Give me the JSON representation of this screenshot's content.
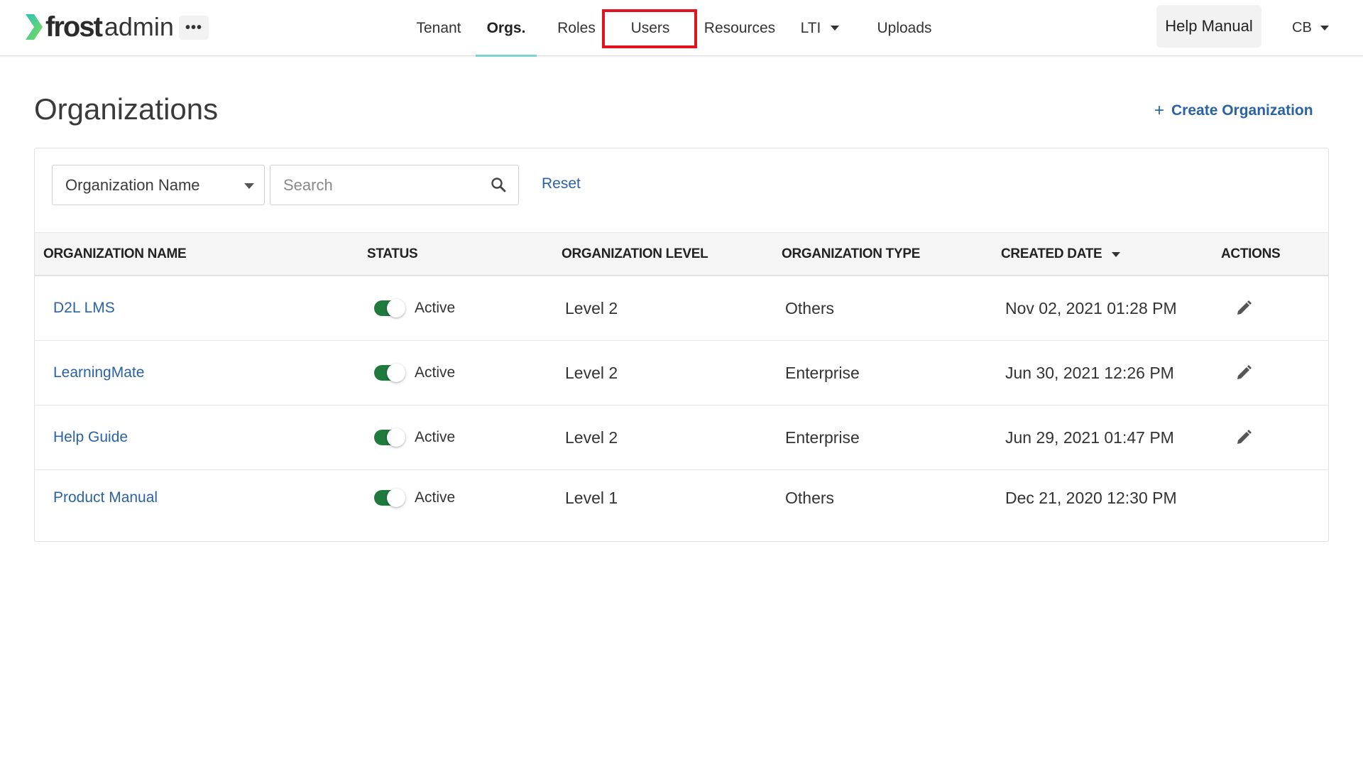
{
  "brand": {
    "name_bold": "frost",
    "name_light": "admin",
    "accent": "#2ec4b6"
  },
  "nav": {
    "more_label": "•••",
    "items": [
      {
        "label": "Tenant"
      },
      {
        "label": "Orgs.",
        "active": true
      },
      {
        "label": "Roles"
      },
      {
        "label": "Users"
      },
      {
        "label": "Resources"
      },
      {
        "label": "LTI",
        "has_dropdown": true
      },
      {
        "label": "Uploads"
      }
    ],
    "help_label": "Help Manual",
    "user_initials": "CB"
  },
  "page": {
    "title": "Organizations",
    "create_label": "Create Organization",
    "create_icon": "+"
  },
  "filters": {
    "field_selected": "Organization Name",
    "search_placeholder": "Search",
    "reset_label": "Reset"
  },
  "table": {
    "columns": [
      "ORGANIZATION NAME",
      "STATUS",
      "ORGANIZATION LEVEL",
      "ORGANIZATION TYPE",
      "CREATED DATE",
      "ACTIONS"
    ],
    "sort_column": "CREATED DATE",
    "rows": [
      {
        "name": "D2L LMS",
        "status": "Active",
        "level": "Level 2",
        "type": "Others",
        "created": "Nov 02, 2021 01:28 PM",
        "editable": true
      },
      {
        "name": "LearningMate",
        "status": "Active",
        "level": "Level 2",
        "type": "Enterprise",
        "created": "Jun 30, 2021 12:26 PM",
        "editable": true
      },
      {
        "name": "Help Guide",
        "status": "Active",
        "level": "Level 2",
        "type": "Enterprise",
        "created": "Jun 29, 2021 01:47 PM",
        "editable": true
      },
      {
        "name": "Product Manual",
        "status": "Active",
        "level": "Level 1",
        "type": "Others",
        "created": "Dec 21, 2020 12:30 PM",
        "editable": false
      }
    ]
  },
  "colors": {
    "link": "#2a62a6",
    "toggle_on": "#1f7a3e",
    "active_tab_underline": "#7dd3d0",
    "highlight": "#e0141f"
  }
}
